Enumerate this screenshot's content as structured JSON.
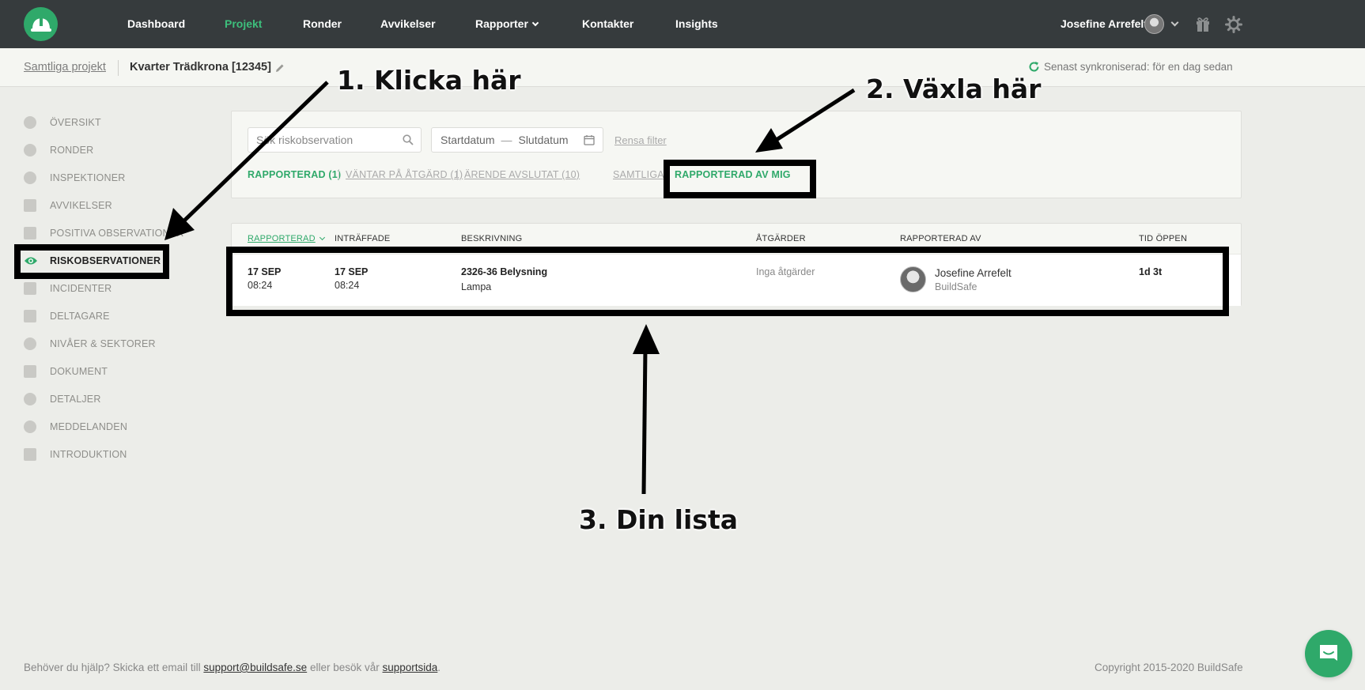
{
  "nav": {
    "items": [
      "Dashboard",
      "Projekt",
      "Ronder",
      "Avvikelser",
      "Rapporter",
      "Kontakter",
      "Insights"
    ],
    "active": "Projekt",
    "user_name": "Josefine Arrefelt"
  },
  "breadcrumb": {
    "all_projects": "Samtliga projekt",
    "project": "Kvarter Trädkrona [12345]"
  },
  "sync": {
    "text": "Senast synkroniserad: för en dag sedan"
  },
  "sidebar": {
    "items": [
      {
        "label": "ÖVERSIKT",
        "icon": "info-icon"
      },
      {
        "label": "RONDER",
        "icon": "round-icon"
      },
      {
        "label": "INSPEKTIONER",
        "icon": "helmet-icon"
      },
      {
        "label": "AVVIKELSER",
        "icon": "deviation-icon"
      },
      {
        "label": "POSITIVA OBSERVATIONER",
        "icon": "thumbs-up-icon"
      },
      {
        "label": "RISKOBSERVATIONER",
        "icon": "eye-icon"
      },
      {
        "label": "INCIDENTER",
        "icon": "incident-icon"
      },
      {
        "label": "DELTAGARE",
        "icon": "person-icon"
      },
      {
        "label": "NIVÅER & SEKTORER",
        "icon": "location-icon"
      },
      {
        "label": "DOKUMENT",
        "icon": "document-icon"
      },
      {
        "label": "DETALJER",
        "icon": "more-icon"
      },
      {
        "label": "MEDDELANDEN",
        "icon": "bell-icon"
      },
      {
        "label": "INTRODUKTION",
        "icon": "checklist-icon"
      }
    ],
    "active": "RISKOBSERVATIONER"
  },
  "filters": {
    "search_placeholder": "Sök riskobservation",
    "start_date": "Startdatum",
    "date_separator": "—",
    "end_date": "Slutdatum",
    "clear": "Rensa filter",
    "status_tabs": [
      "RAPPORTERAD (1)",
      "VÄNTAR PÅ ÅTGÄRD (1)",
      "ÄRENDE AVSLUTAT (10)"
    ],
    "owner_tabs": [
      "SAMTLIGA",
      "RAPPORTERAD AV MIG"
    ]
  },
  "table": {
    "columns": [
      "RAPPORTERAD",
      "INTRÄFFADE",
      "BESKRIVNING",
      "ÅTGÄRDER",
      "RAPPORTERAD AV",
      "TID ÖPPEN"
    ],
    "rows": [
      {
        "reported_date": "17 SEP",
        "reported_time": "08:24",
        "occurred_date": "17 SEP",
        "occurred_time": "08:24",
        "title": "2326-36 Belysning",
        "subtitle": "Lampa",
        "actions": "Inga åtgärder",
        "reporter_name": "Josefine Arrefelt",
        "reporter_company": "BuildSafe",
        "time_open": "1d 3t"
      }
    ]
  },
  "annotations": {
    "step1": "1. Klicka här",
    "step2": "2. Växla här",
    "step3": "3. Din lista"
  },
  "footer": {
    "help_prefix": "Behöver du hjälp? Skicka ett email till",
    "email": "support@buildsafe.se",
    "help_middle": "eller besök vår",
    "support_link": "supportsida",
    "help_suffix": ".",
    "copyright": "Copyright 2015-2020 BuildSafe"
  },
  "colors": {
    "accent": "#2fa96a",
    "topbar": "#363b3d",
    "background": "#ecede9"
  }
}
